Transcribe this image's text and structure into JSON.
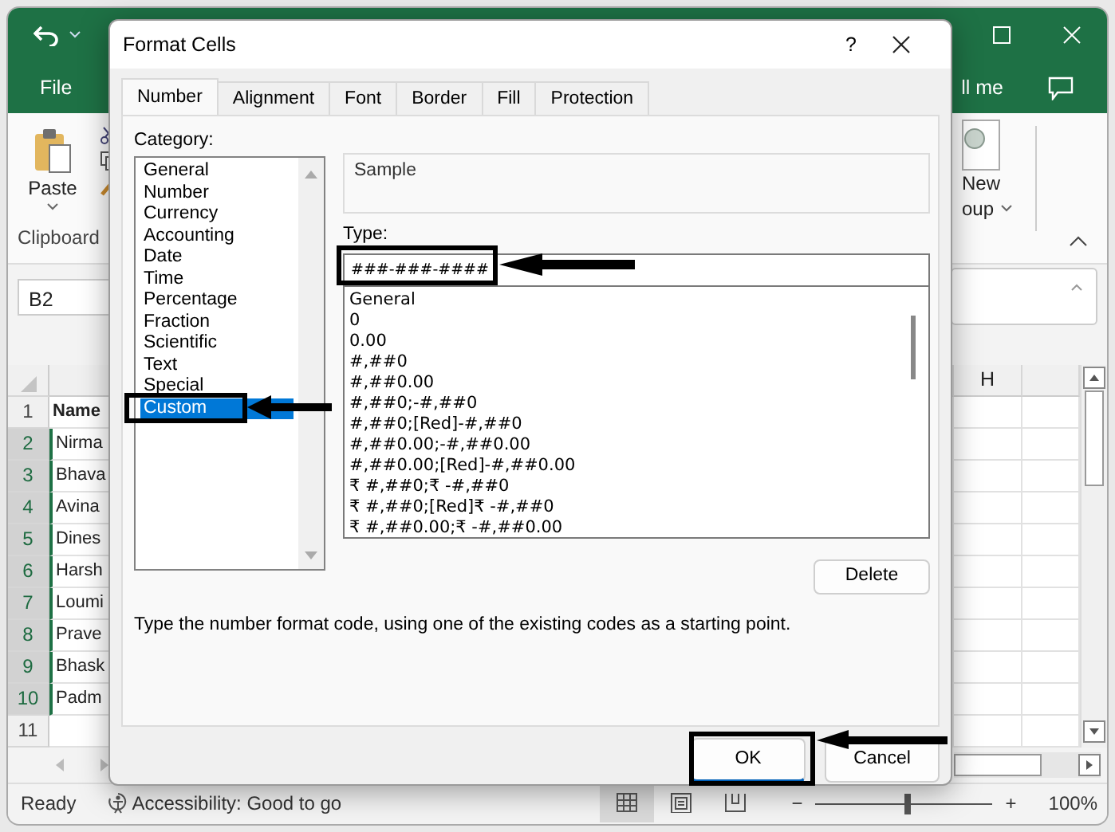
{
  "excel": {
    "file_tab": "File",
    "tell_me": "ll me",
    "ribbon": {
      "paste_label": "Paste",
      "clipboard_label": "Clipboard",
      "new_group_line1": "New",
      "new_group_line2": "oup"
    },
    "name_box": "B2",
    "column_headers": [
      "H"
    ],
    "rows": [
      {
        "number": "1",
        "value": "Name",
        "kind": "header",
        "selected": false
      },
      {
        "number": "2",
        "value": "Nirma",
        "kind": "data",
        "selected": true
      },
      {
        "number": "3",
        "value": "Bhava",
        "kind": "data",
        "selected": true
      },
      {
        "number": "4",
        "value": "Avina",
        "kind": "data",
        "selected": true
      },
      {
        "number": "5",
        "value": "Dines",
        "kind": "data",
        "selected": true
      },
      {
        "number": "6",
        "value": "Harsh",
        "kind": "data",
        "selected": true
      },
      {
        "number": "7",
        "value": "Loumi",
        "kind": "data",
        "selected": true
      },
      {
        "number": "8",
        "value": "Prave",
        "kind": "data",
        "selected": true
      },
      {
        "number": "9",
        "value": "Bhask",
        "kind": "data",
        "selected": true
      },
      {
        "number": "10",
        "value": "Padm",
        "kind": "data",
        "selected": true
      },
      {
        "number": "11",
        "kind": "data",
        "selected": false
      }
    ],
    "status_bar": {
      "ready": "Ready",
      "accessibility": "Accessibility: Good to go",
      "view_buttons": [
        {
          "kind": "normal",
          "selected": true
        },
        {
          "kind": "page_layout",
          "selected": false
        },
        {
          "kind": "page_break",
          "selected": false
        }
      ],
      "zoom_out": "−",
      "zoom_in": "+",
      "zoom": {
        "level": 0.52
      },
      "zoom_reading": "100%"
    }
  },
  "dialog": {
    "title": "Format Cells",
    "help": "?",
    "tabs": [
      {
        "label": "Number",
        "selected": true
      },
      {
        "label": "Alignment",
        "selected": false
      },
      {
        "label": "Font",
        "selected": false
      },
      {
        "label": "Border",
        "selected": false
      },
      {
        "label": "Fill",
        "selected": false
      },
      {
        "label": "Protection",
        "selected": false
      }
    ],
    "category_label": "Category:",
    "categories": [
      {
        "label": "General",
        "selected": false
      },
      {
        "label": "Number",
        "selected": false
      },
      {
        "label": "Currency",
        "selected": false
      },
      {
        "label": "Accounting",
        "selected": false
      },
      {
        "label": "Date",
        "selected": false
      },
      {
        "label": "Time",
        "selected": false
      },
      {
        "label": "Percentage",
        "selected": false
      },
      {
        "label": "Fraction",
        "selected": false
      },
      {
        "label": "Scientific",
        "selected": false
      },
      {
        "label": "Text",
        "selected": false
      },
      {
        "label": "Special",
        "selected": false
      },
      {
        "label": "Custom",
        "selected": true
      }
    ],
    "sample_label": "Sample",
    "type_label": "Type:",
    "type_value": "###-###-####",
    "formats": [
      "General",
      "0",
      "0.00",
      "#,##0",
      "#,##0.00",
      "#,##0;-#,##0",
      "#,##0;[Red]-#,##0",
      "#,##0.00;-#,##0.00",
      "#,##0.00;[Red]-#,##0.00",
      "₹ #,##0;₹ -#,##0",
      "₹ #,##0;[Red]₹ -#,##0",
      "₹ #,##0.00;₹ -#,##0.00"
    ],
    "delete_button": "Delete",
    "description": "Type the number format code, using one of the existing codes as a starting point.",
    "buttons": [
      {
        "label": "OK",
        "kind": "default"
      },
      {
        "label": "Cancel",
        "kind": "normal"
      }
    ]
  }
}
